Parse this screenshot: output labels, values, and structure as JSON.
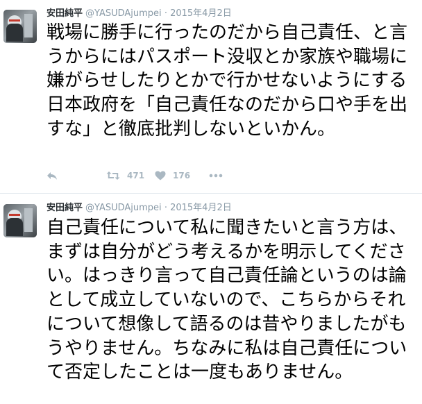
{
  "tweets": [
    {
      "fullname": "安田純平",
      "handle": "@YASUDAjumpei",
      "separator": "·",
      "timestamp": "2015年4月2日",
      "text": "戦場に勝手に行ったのだから自己責任、と言うからにはパスポート没収とか家族や職場に嫌がらせしたりとかで行かせないようにする日本政府を「自己責任なのだから口や手を出すな」と徹底批判しないといかん。",
      "retweet_count": "471",
      "like_count": "176"
    },
    {
      "fullname": "安田純平",
      "handle": "@YASUDAjumpei",
      "separator": "·",
      "timestamp": "2015年4月2日",
      "text": "自己責任について私に聞きたいと言う方は、まずは自分がどう考えるかを明示してください。はっきり言って自己責任論というのは論として成立していないので、こちらからそれについて想像して語るのは昔やりましたがもうやりません。ちなみに私は自己責任について否定したことは一度もありません。"
    }
  ],
  "icons": {
    "reply": "reply-icon",
    "retweet": "retweet-icon",
    "like": "heart-icon",
    "more": "more-dots-icon"
  },
  "colors": {
    "meta": "#8899a6",
    "action": "#aab8c2",
    "divider": "#e1e8ed"
  }
}
